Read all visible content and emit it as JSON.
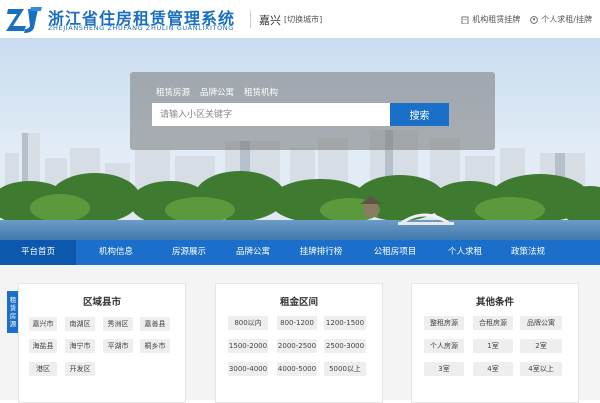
{
  "header": {
    "logo_text": "浙江省住房租赁管理系统",
    "logo_subtext": "ZHEJIANSHENG ZHUFANG ZHULIN GUANLIXITONG",
    "city": "嘉兴",
    "city_switch": "[切换城市]",
    "links": [
      "机构租赁挂牌",
      "个人求租/挂牌"
    ]
  },
  "search": {
    "tabs": [
      "租赁房源",
      "品牌公寓",
      "租赁机构"
    ],
    "placeholder": "请输入小区关键字",
    "button_label": "搜索"
  },
  "nav": {
    "items": [
      "平台首页",
      "机构信息",
      "房源展示",
      "品牌公寓",
      "挂牌排行榜",
      "公租房项目",
      "个人求租",
      "政策法规"
    ],
    "active_index": 0
  },
  "side_tag": "租赁房源",
  "panels": {
    "district": {
      "title": "区域县市",
      "items": [
        "嘉兴市",
        "南湖区",
        "秀洲区",
        "嘉善县",
        "海盐县",
        "海宁市",
        "平湖市",
        "桐乡市",
        "港区",
        "开发区"
      ]
    },
    "rent": {
      "title": "租金区间",
      "items": [
        "800以内",
        "800-1200",
        "1200-1500",
        "1500-2000",
        "2000-2500",
        "2500-3000",
        "3000-4000",
        "4000-5000",
        "5000以上"
      ]
    },
    "other": {
      "title": "其他条件",
      "items": [
        "整租房源",
        "合租房源",
        "品牌公寓",
        "个人房源",
        "1室",
        "2室",
        "3室",
        "4室",
        "4室以上"
      ]
    }
  },
  "colors": {
    "brand_blue": "#1b6fcb",
    "nav_active": "#0b58ad",
    "search_button": "#1a6fc8"
  }
}
